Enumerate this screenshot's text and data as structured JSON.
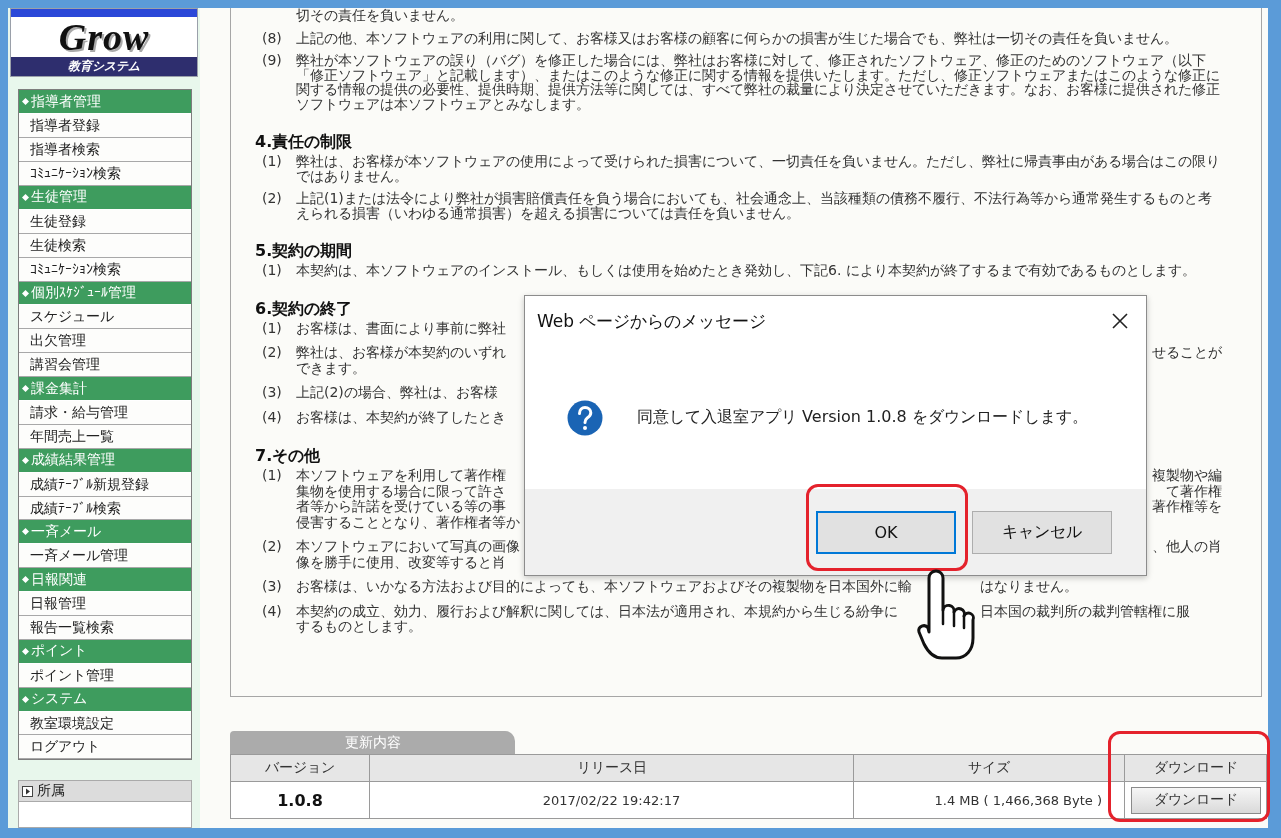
{
  "sidebar": {
    "logo": {
      "wordmark": "Grow",
      "subtitle": "教育システム"
    },
    "menu": [
      {
        "title": "指導者管理",
        "items": [
          "指導者登録",
          "指導者検索",
          "ｺﾐｭﾆｹｰｼｮﾝ検索"
        ]
      },
      {
        "title": "生徒管理",
        "items": [
          "生徒登録",
          "生徒検索",
          "ｺﾐｭﾆｹｰｼｮﾝ検索"
        ]
      },
      {
        "title": "個別ｽｹｼﾞｭｰﾙ管理",
        "items": [
          "スケジュール",
          "出欠管理",
          "講習会管理"
        ]
      },
      {
        "title": "課金集計",
        "items": [
          "請求・給与管理",
          "年間売上一覧"
        ]
      },
      {
        "title": "成績結果管理",
        "items": [
          "成績ﾃｰﾌﾞﾙ新規登録",
          "成績ﾃｰﾌﾞﾙ検索"
        ]
      },
      {
        "title": "一斉メール",
        "items": [
          "一斉メール管理"
        ]
      },
      {
        "title": "日報関連",
        "items": [
          "日報管理",
          "報告一覧検索"
        ]
      },
      {
        "title": "ポイント",
        "items": [
          "ポイント管理"
        ]
      },
      {
        "title": "システム",
        "items": [
          "教室環境設定",
          "ログアウト"
        ]
      }
    ],
    "affiliation": {
      "label": "所属",
      "expanded": false
    }
  },
  "terms": {
    "blocks": [
      {
        "kind": "continuation",
        "text": "切その責任を負いません。"
      },
      {
        "kind": "item",
        "number": "(8)",
        "text": "上記の他、本ソフトウェアの利用に関して、お客様又はお客様の顧客に何らかの損害が生じた場合でも、弊社は一切その責任を負いません。"
      },
      {
        "kind": "item",
        "number": "(9)",
        "text": "弊社が本ソフトウェアの誤り（バグ）を修正した場合には、弊社はお客様に対して、修正されたソフトウェア、修正のためのソフトウェア（以下「修正ソフトウェア」と記載します）、またはこのような修正に関する情報を提供いたします。ただし、修正ソフトウェアまたはこのような修正に関する情報の提供の必要性、提供時期、提供方法等に関しては、すべて弊社の裁量により決定させていただきます。なお、お客様に提供された修正ソフトウェアは本ソフトウェアとみなします。"
      },
      {
        "kind": "heading",
        "text": "4.責任の制限"
      },
      {
        "kind": "item",
        "number": "(1)",
        "text": "弊社は、お客様が本ソフトウェアの使用によって受けられた損害について、一切責任を負いません。ただし、弊社に帰責事由がある場合はこの限りではありません。"
      },
      {
        "kind": "item",
        "number": "(2)",
        "text": "上記(1)または法令により弊社が損害賠償責任を負う場合においても、社会通念上、当該種類の債務不履行、不法行為等から通常発生するものと考えられる損害（いわゆる通常損害）を超える損害については責任を負いません。"
      },
      {
        "kind": "heading",
        "text": "5.契約の期間"
      },
      {
        "kind": "item",
        "number": "(1)",
        "text": "本契約は、本ソフトウェアのインストール、もしくは使用を始めたとき発効し、下記6. により本契約が終了するまで有効であるものとします。"
      },
      {
        "kind": "heading",
        "text": "6.契約の終了"
      },
      {
        "kind": "covered",
        "number": "(1)",
        "lines": [
          {
            "kind": "plain",
            "left": "お客様は、書面により事前に弊社"
          }
        ]
      },
      {
        "kind": "covered",
        "number": "(2)",
        "lines": [
          {
            "kind": "split_wide",
            "left": "弊社は、お客様が本契約のいずれ",
            "right": "せることが"
          },
          {
            "kind": "plain",
            "left": "できます。"
          }
        ]
      },
      {
        "kind": "covered",
        "number": "(3)",
        "lines": [
          {
            "kind": "plain",
            "left": "上記(2)の場合、弊社は、お客様"
          }
        ]
      },
      {
        "kind": "covered",
        "number": "(4)",
        "lines": [
          {
            "kind": "plain",
            "left": "お客様は、本契約が終了したとき"
          }
        ]
      },
      {
        "kind": "heading",
        "text": "7.その他"
      },
      {
        "kind": "covered",
        "number": "(1)",
        "lines": [
          {
            "kind": "split_wide",
            "left": "本ソフトウェアを利用して著作権",
            "right": "複製物や編"
          },
          {
            "kind": "split_wide",
            "left": "集物を使用する場合に限って許さ",
            "right": "て著作権"
          },
          {
            "kind": "split_wide",
            "left": "者等から許諾を受けている等の事",
            "right": "著作権等を"
          },
          {
            "kind": "plain",
            "left": "侵害することとなり、著作権者等か"
          }
        ]
      },
      {
        "kind": "covered",
        "number": "(2)",
        "lines": [
          {
            "kind": "split_wide",
            "left": "本ソフトウェアにおいて写真の画像",
            "right": "、他人の肖"
          },
          {
            "kind": "plain",
            "left": "像を勝手に使用、改変等すると肖"
          }
        ]
      },
      {
        "kind": "covered",
        "number": "(3)",
        "lines": [
          {
            "kind": "split_narrow",
            "left": "お客様は、いかなる方法および目的によっても、本ソフトウェアおよびその複製物を日本国外に輸",
            "right": "はなりません。"
          }
        ]
      },
      {
        "kind": "covered",
        "number": "(4)",
        "lines": [
          {
            "kind": "split_narrow",
            "left": "本契約の成立、効力、履行および解釈に関しては、日本法が適用され、本規約から生じる紛争に",
            "right": "日本国の裁判所の裁判管轄権に服"
          },
          {
            "kind": "plain",
            "left": "するものとします。"
          }
        ]
      }
    ]
  },
  "updates": {
    "tab": "更新内容",
    "columns": [
      {
        "label": "バージョン",
        "highlighted": false
      },
      {
        "label": "リリース日",
        "highlighted": false
      },
      {
        "label": "サイズ",
        "highlighted": false
      },
      {
        "label": "ダウンロード",
        "highlighted": true
      }
    ],
    "rows": [
      {
        "version": "1.0.8",
        "release_date": "2017/02/22 19:42:17",
        "size": "1.4 MB ( 1,466,368 Byte )",
        "download": "ダウンロード"
      }
    ]
  },
  "dialog": {
    "title": "Web ページからのメッセージ",
    "message": "同意して入退室アプリ Version 1.0.8 をダウンロードします。",
    "buttons": [
      {
        "label": "OK",
        "focused": true,
        "highlighted": true
      },
      {
        "label": "キャンセル",
        "focused": false,
        "highlighted": false
      }
    ]
  }
}
